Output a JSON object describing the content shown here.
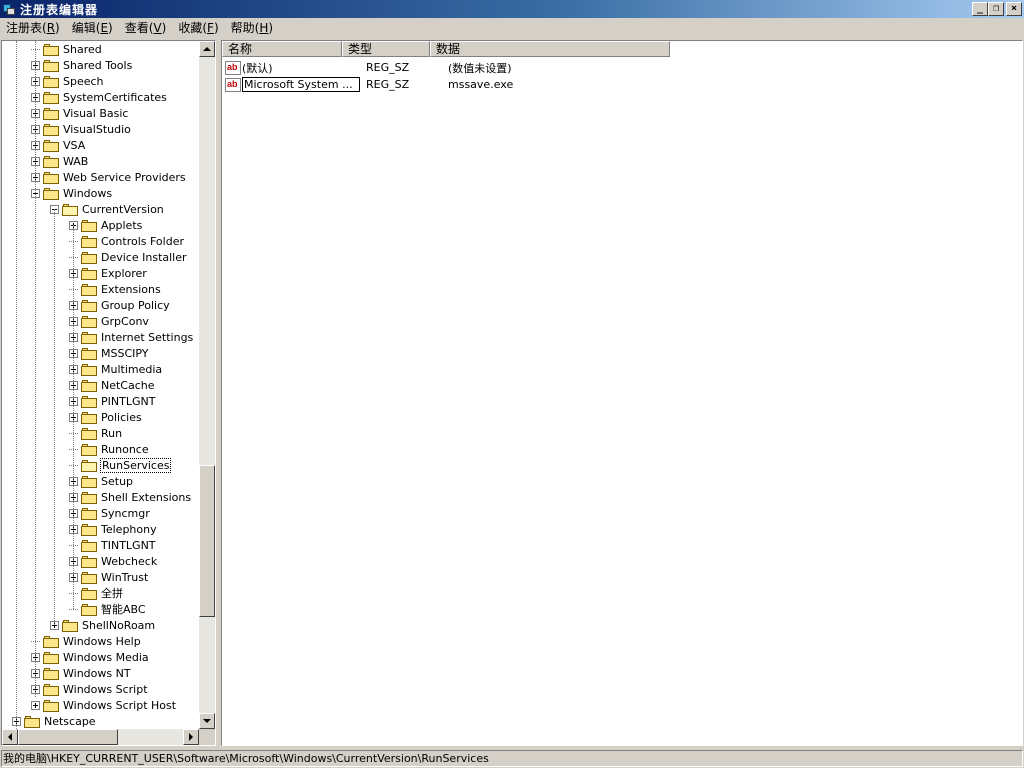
{
  "window": {
    "title": "注册表编辑器",
    "minimize": "_",
    "restore": "❐",
    "close": "×"
  },
  "menu": [
    {
      "label": "注册表",
      "key": "R"
    },
    {
      "label": "编辑",
      "key": "E"
    },
    {
      "label": "查看",
      "key": "V"
    },
    {
      "label": "收藏",
      "key": "F"
    },
    {
      "label": "帮助",
      "key": "H"
    }
  ],
  "tree": [
    {
      "label": "Shared",
      "depth": 2,
      "expand": "none"
    },
    {
      "label": "Shared Tools",
      "depth": 2,
      "expand": "plus"
    },
    {
      "label": "Speech",
      "depth": 2,
      "expand": "plus"
    },
    {
      "label": "SystemCertificates",
      "depth": 2,
      "expand": "plus"
    },
    {
      "label": "Visual Basic",
      "depth": 2,
      "expand": "plus"
    },
    {
      "label": "VisualStudio",
      "depth": 2,
      "expand": "plus"
    },
    {
      "label": "VSA",
      "depth": 2,
      "expand": "plus"
    },
    {
      "label": "WAB",
      "depth": 2,
      "expand": "plus"
    },
    {
      "label": "Web Service Providers",
      "depth": 2,
      "expand": "plus"
    },
    {
      "label": "Windows",
      "depth": 2,
      "expand": "minus"
    },
    {
      "label": "CurrentVersion",
      "depth": 3,
      "expand": "minus",
      "open": true
    },
    {
      "label": "Applets",
      "depth": 4,
      "expand": "plus"
    },
    {
      "label": "Controls Folder",
      "depth": 4,
      "expand": "none"
    },
    {
      "label": "Device Installer",
      "depth": 4,
      "expand": "none"
    },
    {
      "label": "Explorer",
      "depth": 4,
      "expand": "plus"
    },
    {
      "label": "Extensions",
      "depth": 4,
      "expand": "none"
    },
    {
      "label": "Group Policy",
      "depth": 4,
      "expand": "plus"
    },
    {
      "label": "GrpConv",
      "depth": 4,
      "expand": "plus"
    },
    {
      "label": "Internet Settings",
      "depth": 4,
      "expand": "plus"
    },
    {
      "label": "MSSCIPY",
      "depth": 4,
      "expand": "plus"
    },
    {
      "label": "Multimedia",
      "depth": 4,
      "expand": "plus"
    },
    {
      "label": "NetCache",
      "depth": 4,
      "expand": "plus"
    },
    {
      "label": "PINTLGNT",
      "depth": 4,
      "expand": "plus"
    },
    {
      "label": "Policies",
      "depth": 4,
      "expand": "plus"
    },
    {
      "label": "Run",
      "depth": 4,
      "expand": "none"
    },
    {
      "label": "Runonce",
      "depth": 4,
      "expand": "none"
    },
    {
      "label": "RunServices",
      "depth": 4,
      "expand": "none",
      "selected": true,
      "open": true
    },
    {
      "label": "Setup",
      "depth": 4,
      "expand": "plus"
    },
    {
      "label": "Shell Extensions",
      "depth": 4,
      "expand": "plus"
    },
    {
      "label": "Syncmgr",
      "depth": 4,
      "expand": "plus"
    },
    {
      "label": "Telephony",
      "depth": 4,
      "expand": "plus"
    },
    {
      "label": "TINTLGNT",
      "depth": 4,
      "expand": "none"
    },
    {
      "label": "Webcheck",
      "depth": 4,
      "expand": "plus"
    },
    {
      "label": "WinTrust",
      "depth": 4,
      "expand": "plus"
    },
    {
      "label": "全拼",
      "depth": 4,
      "expand": "none"
    },
    {
      "label": "智能ABC",
      "depth": 4,
      "expand": "none"
    },
    {
      "label": "ShellNoRoam",
      "depth": 3,
      "expand": "plus"
    },
    {
      "label": "Windows Help",
      "depth": 2,
      "expand": "none"
    },
    {
      "label": "Windows Media",
      "depth": 2,
      "expand": "plus"
    },
    {
      "label": "Windows NT",
      "depth": 2,
      "expand": "plus"
    },
    {
      "label": "Windows Script",
      "depth": 2,
      "expand": "plus"
    },
    {
      "label": "Windows Script Host",
      "depth": 2,
      "expand": "plus"
    },
    {
      "label": "Netscape",
      "depth": 1,
      "expand": "plus"
    }
  ],
  "list": {
    "columns": [
      "名称",
      "类型",
      "数据"
    ],
    "rows": [
      {
        "name": "(默认)",
        "type": "REG_SZ",
        "data": "(数值未设置)",
        "icon": "ab"
      },
      {
        "name": "Microsoft System ...",
        "type": "REG_SZ",
        "data": "mssave.exe",
        "icon": "ab",
        "editing": true
      }
    ]
  },
  "statusbar": {
    "path": "我的电脑\\HKEY_CURRENT_USER\\Software\\Microsoft\\Windows\\CurrentVersion\\RunServices"
  }
}
